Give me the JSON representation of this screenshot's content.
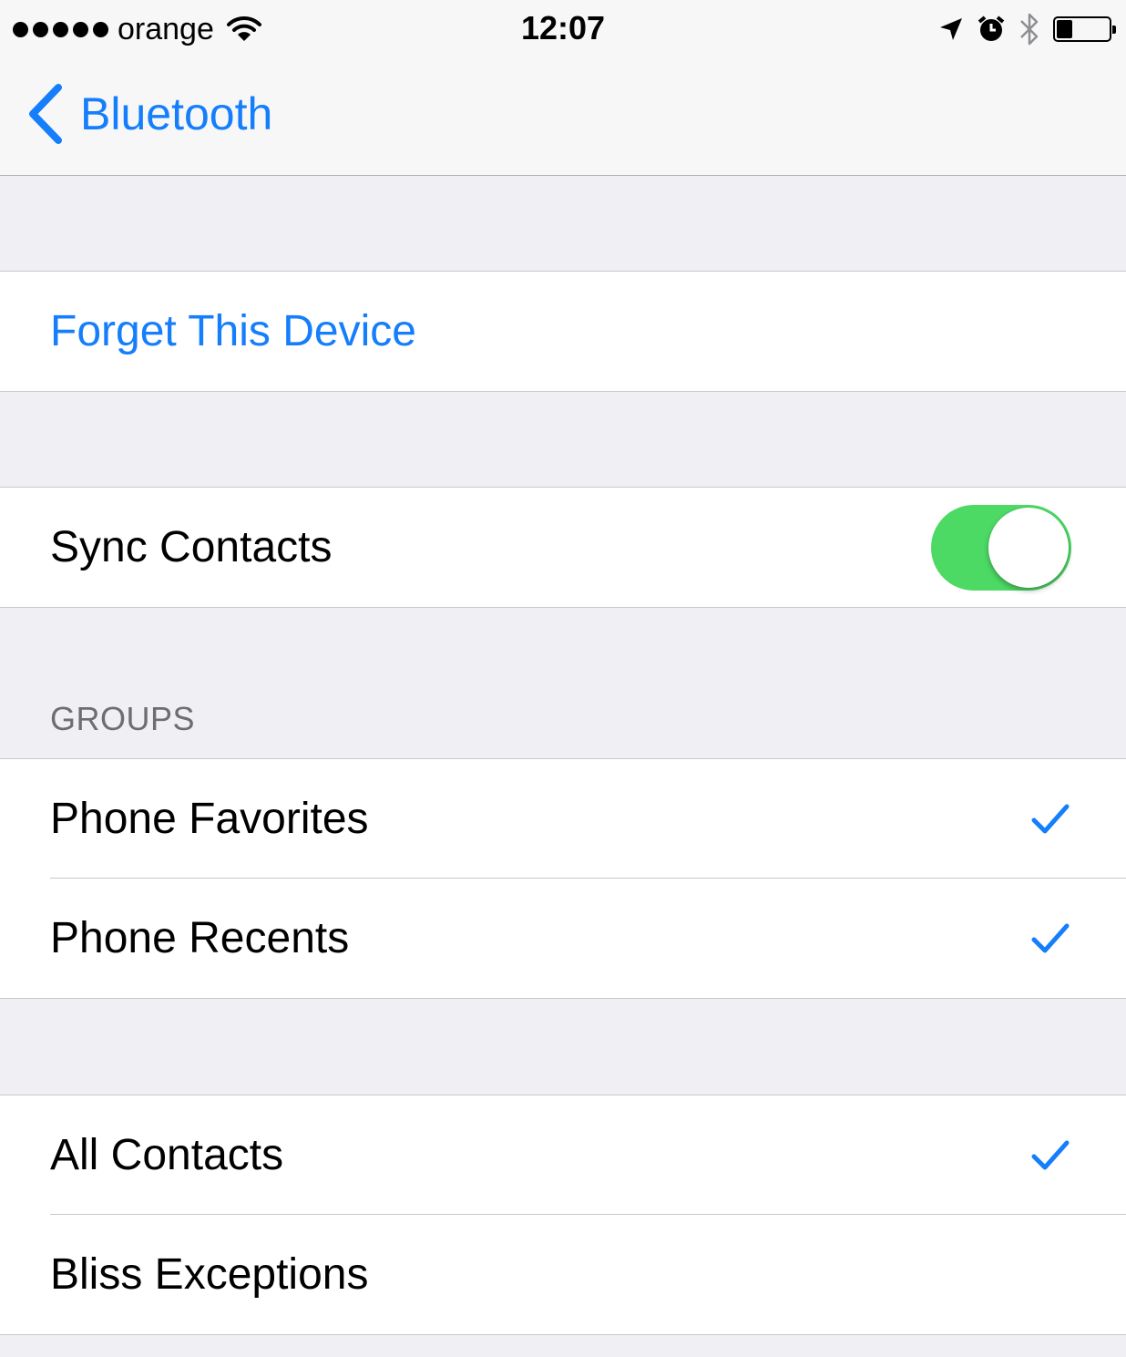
{
  "status_bar": {
    "signal_dots": 5,
    "carrier": "orange",
    "time": "12:07",
    "icons": [
      "wifi-icon",
      "location-arrow-icon",
      "alarm-clock-icon",
      "bluetooth-icon",
      "battery-icon"
    ],
    "battery_level_percent": 30
  },
  "nav": {
    "back_label": "Bluetooth"
  },
  "sections": {
    "forget": {
      "label": "Forget This Device"
    },
    "sync": {
      "label": "Sync Contacts",
      "enabled": true
    },
    "groups": {
      "header": "GROUPS",
      "items": [
        {
          "label": "Phone Favorites",
          "checked": true
        },
        {
          "label": "Phone Recents",
          "checked": true
        }
      ]
    },
    "contacts": {
      "items": [
        {
          "label": "All Contacts",
          "checked": true
        },
        {
          "label": "Bliss Exceptions",
          "checked": false
        }
      ]
    }
  },
  "colors": {
    "accent": "#147efb",
    "toggle_on": "#4cd964",
    "grouped_background": "#efeff4"
  }
}
